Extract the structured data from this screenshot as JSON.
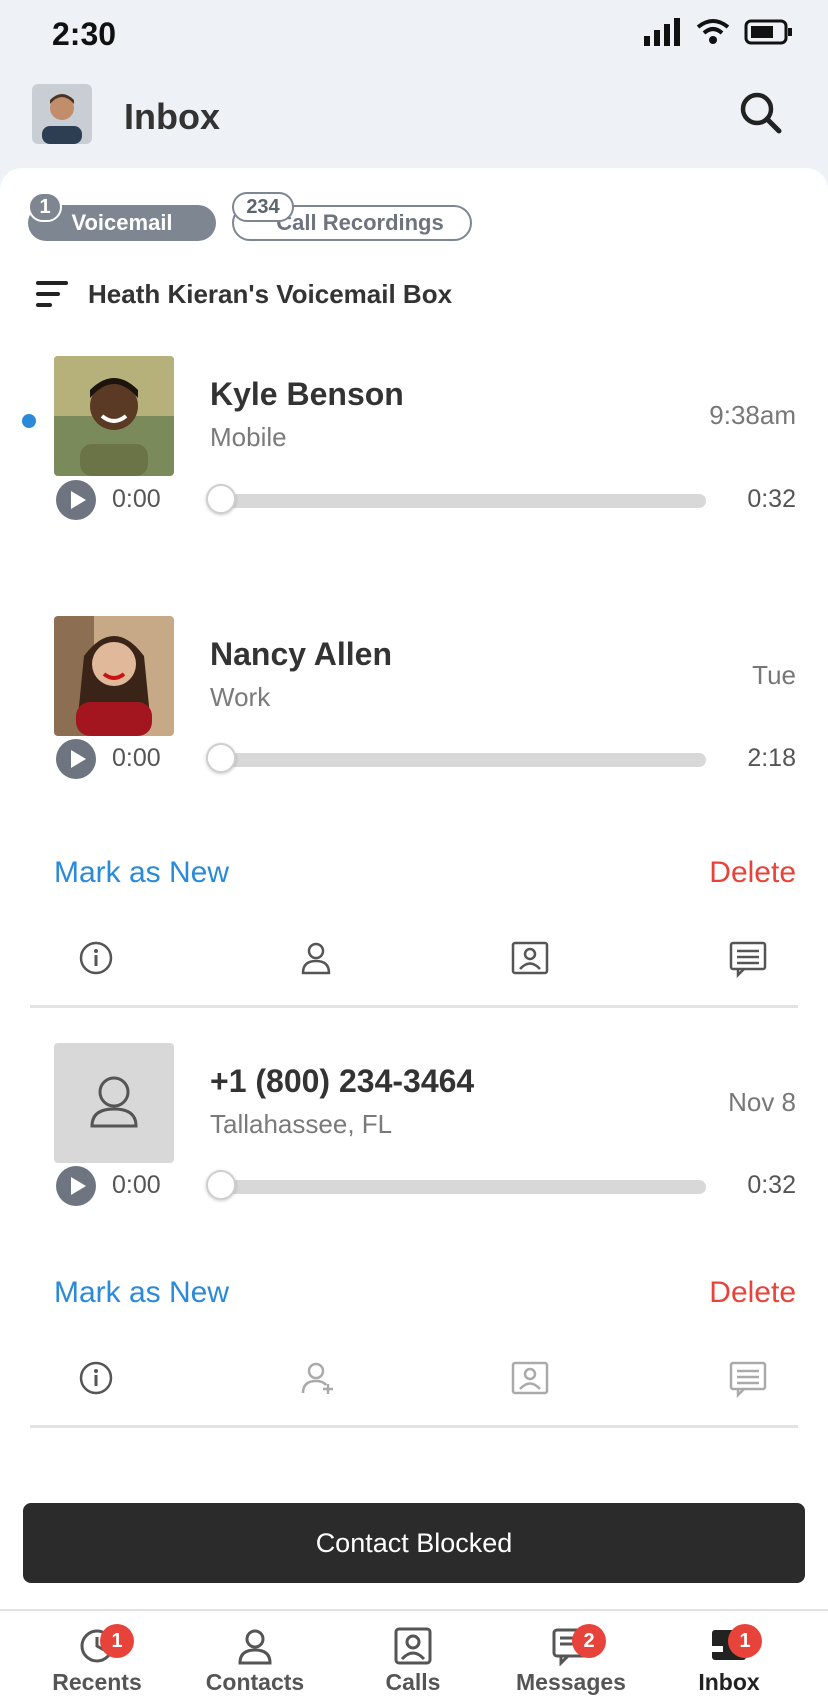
{
  "status_bar": {
    "time": "2:30",
    "icons": [
      "signal-icon",
      "wifi-icon",
      "battery-icon"
    ]
  },
  "header": {
    "title": "Inbox",
    "avatar": "avatar-icon",
    "search_icon": "search-icon"
  },
  "tabs": [
    {
      "label": "Voicemail",
      "badge": "1",
      "active": true
    },
    {
      "label": "Call Recordings",
      "badge": "234",
      "active": false
    }
  ],
  "voicemail_box": {
    "label": "Heath Kieran's Voicemail Box",
    "icon": "filter-icon"
  },
  "voicemails": [
    {
      "name": "Kyle Benson",
      "label": "Mobile",
      "time": "9:38am",
      "current": "0:00",
      "duration": "0:32",
      "unread": true,
      "progress": 0
    },
    {
      "name": "Nancy Allen",
      "label": "Work",
      "time": "Tue",
      "current": "0:00",
      "duration": "2:18",
      "unread": false,
      "progress": 0,
      "mark_as_new": "Mark as New",
      "delete": "Delete"
    },
    {
      "name": "+1 (800) 234-3464",
      "label": "Tallahassee, FL",
      "time": "Nov 8",
      "current": "0:00",
      "duration": "0:32",
      "unread": false,
      "progress": 0,
      "mark_as_new": "Mark as New",
      "delete": "Delete"
    }
  ],
  "toast": {
    "message": "Contact Blocked"
  },
  "bottom_nav": [
    {
      "label": "Recents",
      "icon": "clock-icon",
      "badge": "1"
    },
    {
      "label": "Contacts",
      "icon": "person-icon",
      "badge": ""
    },
    {
      "label": "Calls",
      "icon": "contact-card-icon",
      "badge": ""
    },
    {
      "label": "Messages",
      "icon": "message-icon",
      "badge": "2"
    },
    {
      "label": "Inbox",
      "icon": "inbox-icon",
      "badge": "1",
      "active": true
    }
  ],
  "colors": {
    "accent": "#2a8ad9",
    "danger": "#e8433a",
    "tab_gray": "#7e8692",
    "toast_bg": "#2b2b2b"
  }
}
